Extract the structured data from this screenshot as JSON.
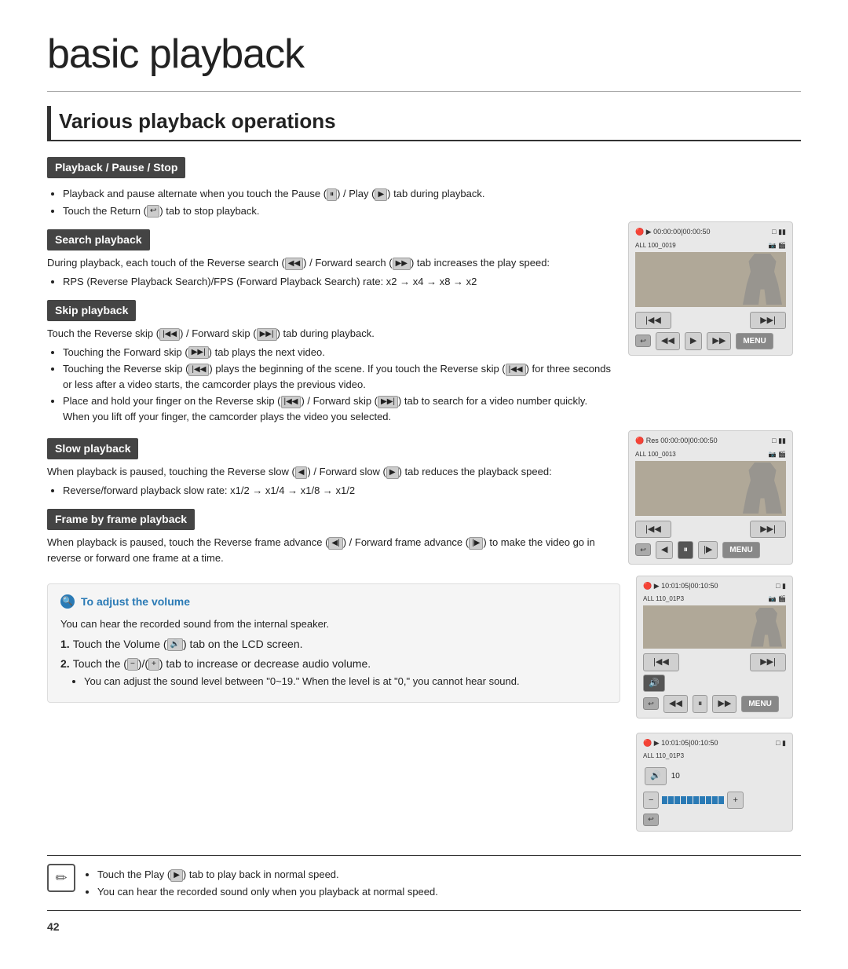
{
  "page": {
    "main_title": "basic playback",
    "section_title": "Various playback operations",
    "page_number": "42"
  },
  "sections": {
    "playback_pause_stop": {
      "header": "Playback / Pause / Stop",
      "bullets": [
        "Playback and pause alternate when you touch the Pause ( ⏸ ) / Play ( ▶ ) tab during playback.",
        "Touch the Return ( ↩ ) tab to stop playback."
      ]
    },
    "search_playback": {
      "header": "Search playback",
      "intro": "During playback, each touch of the Reverse search ( ◀◀ ) / Forward search ( ▶▶ ) tab increases the play speed:",
      "bullets": [
        "RPS (Reverse Playback Search)/FPS (Forward Playback Search) rate: x2 → x4 → x8 → x2"
      ]
    },
    "skip_playback": {
      "header": "Skip playback",
      "intro": "Touch the Reverse skip ( |◀◀ ) / Forward skip ( ▶▶| ) tab during playback.",
      "bullets": [
        "Touching the Forward skip ( ▶▶| ) tab plays the next video.",
        "Touching the Reverse skip ( |◀◀ ) plays the beginning of the scene. If you touch the Reverse skip ( |◀◀ ) for three seconds or less after a video starts, the camcorder plays the previous video.",
        "Place and hold your finger on the Reverse skip ( |◀◀ ) / Forward skip ( ▶▶| ) tab to search for a video number quickly. When you lift off your finger, the camcorder plays the video you selected."
      ]
    },
    "slow_playback": {
      "header": "Slow playback",
      "intro": "When playback is paused, touching the Reverse slow ( ◀ ) / Forward slow ( ▶ ) tab reduces the playback speed:",
      "bullets": [
        "Reverse/forward playback slow rate: x1/2 → x1/4 → x1/8 → x1/2"
      ]
    },
    "frame_by_frame": {
      "header": "Frame by frame playback",
      "text": "When playback is paused, touch the Reverse frame advance ( ◀| ) / Forward frame advance ( |▶ ) to make the video go in reverse or forward one frame at a time."
    },
    "volume": {
      "header": "To adjust the volume",
      "intro": "You can hear the recorded sound from the internal speaker.",
      "steps": [
        {
          "num": "1.",
          "text": "Touch the Volume ( 🔊 ) tab on the LCD screen."
        },
        {
          "num": "2.",
          "text": "Touch the ( − )/( + ) tab to increase or decrease audio volume."
        }
      ],
      "sub_bullet": "You can adjust the sound level between \"0~19.\" When the level is at \"0,\" you cannot hear sound."
    },
    "note": {
      "bullets": [
        "Touch the Play ( ▶ ) tab to play back in normal speed.",
        "You can hear the recorded sound only when you playback at normal speed."
      ]
    }
  }
}
